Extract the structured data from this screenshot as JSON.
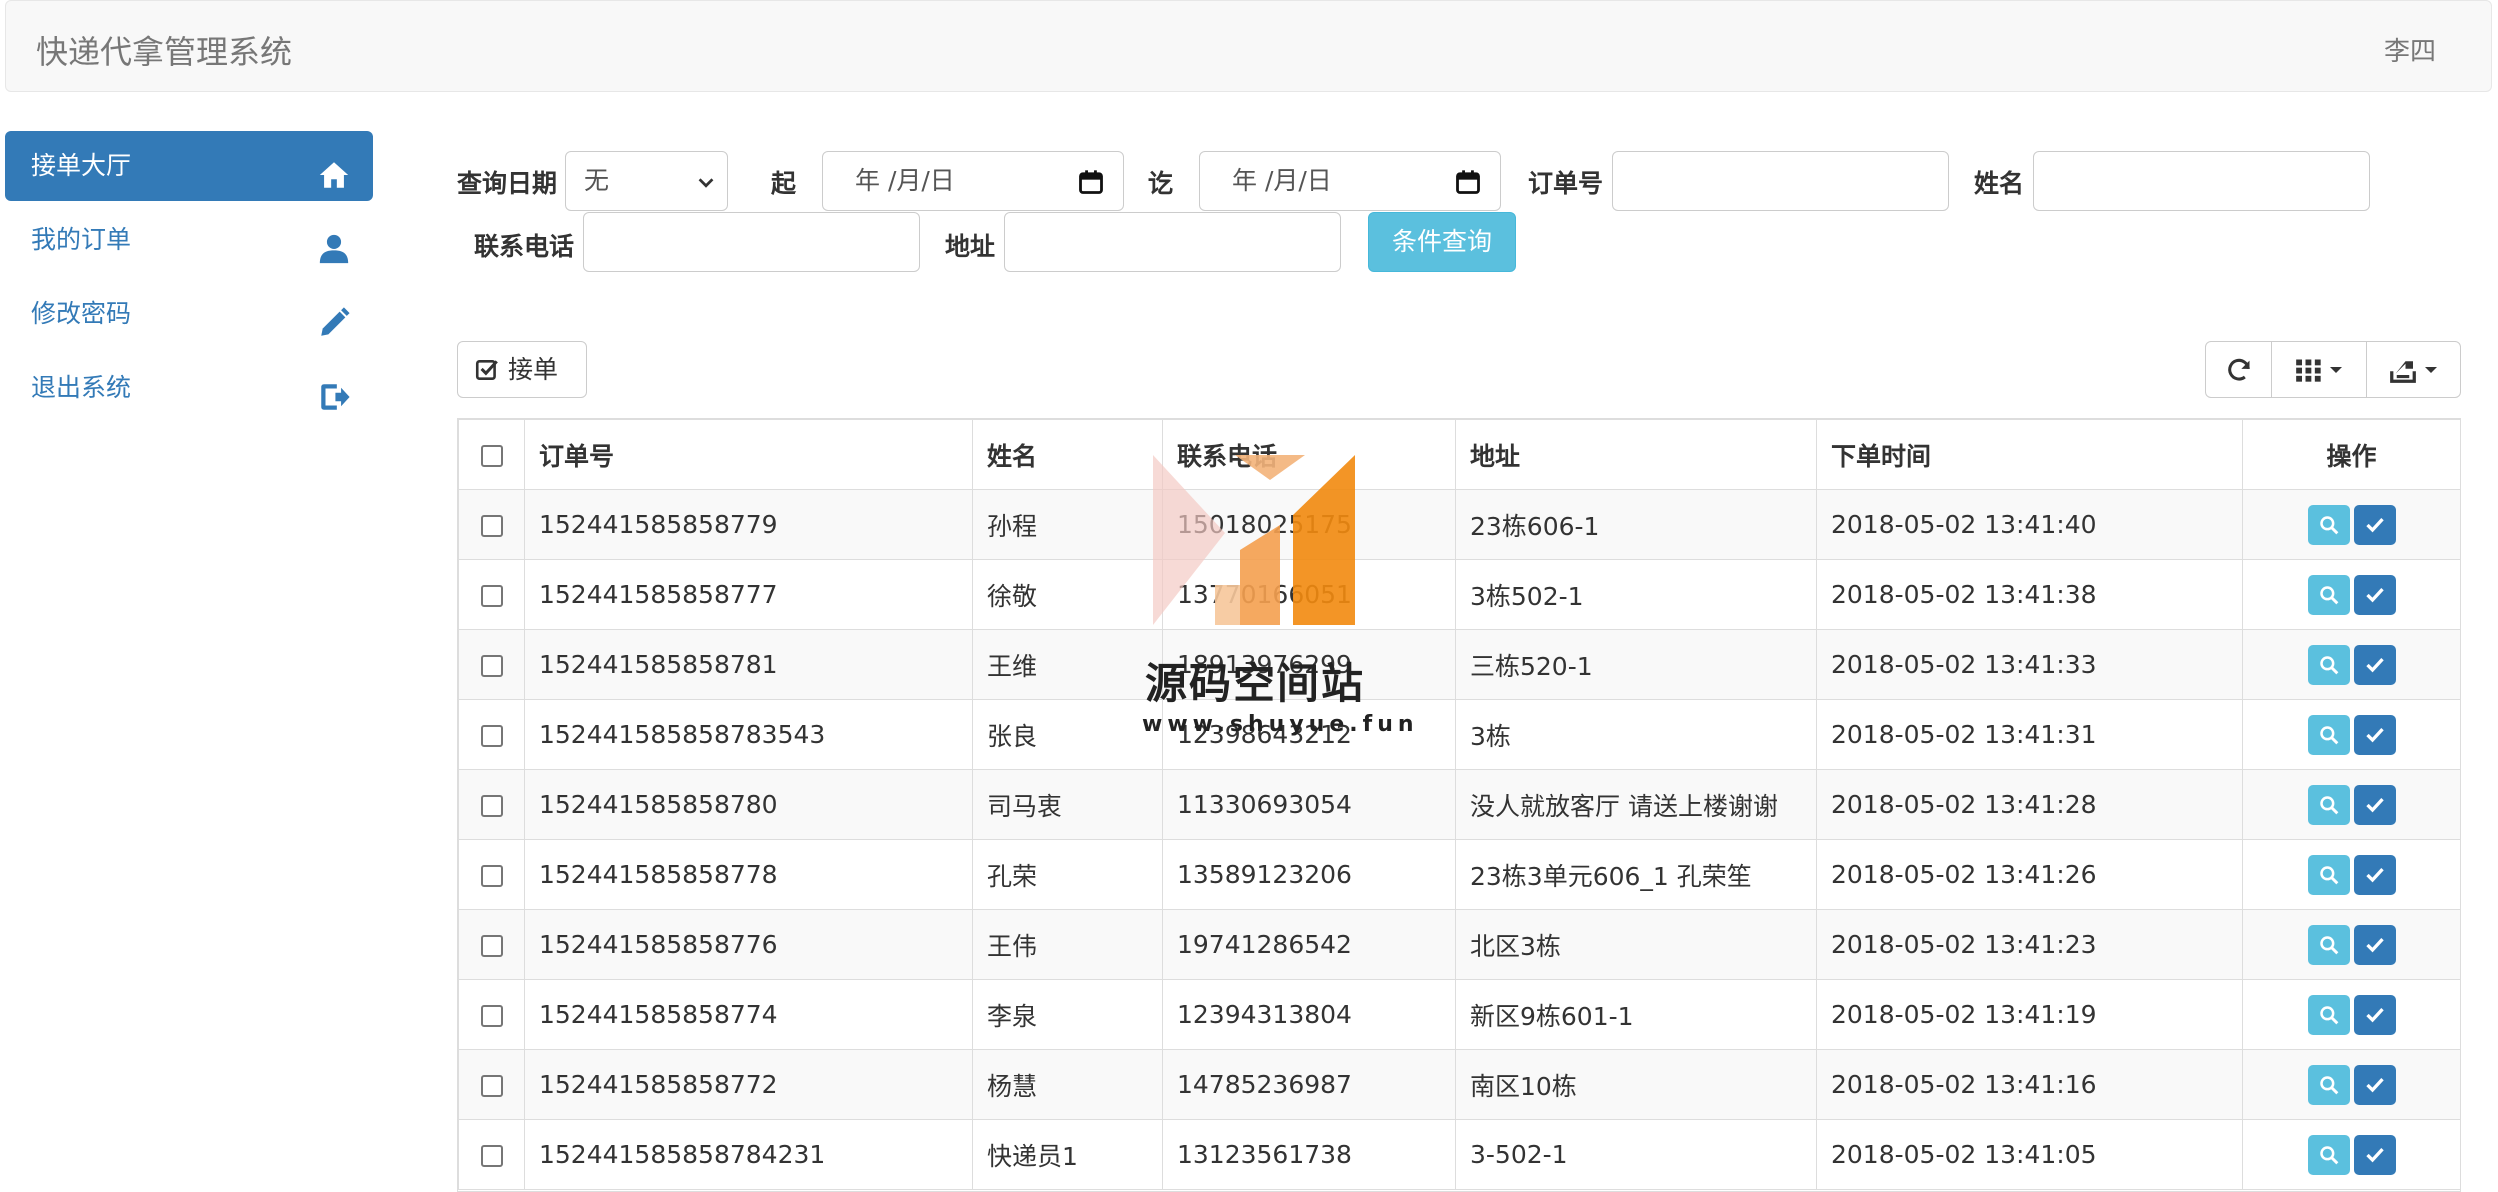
{
  "app": {
    "title": "快递代拿管理系统",
    "user": "李四"
  },
  "sidebar": {
    "items": [
      {
        "label": "接单大厅",
        "icon": "home-icon",
        "active": true
      },
      {
        "label": "我的订单",
        "icon": "user-icon"
      },
      {
        "label": "修改密码",
        "icon": "pencil-icon"
      },
      {
        "label": "退出系统",
        "icon": "logout-icon"
      }
    ]
  },
  "search": {
    "date_label": "查询日期",
    "date_select_value": "无",
    "from_label": "起",
    "from_placeholder": "年 /月/日",
    "to_label": "讫",
    "to_placeholder": "年 /月/日",
    "order_label": "订单号",
    "name_label": "姓名",
    "phone_label": "联系电话",
    "address_label": "地址",
    "button": "条件查询"
  },
  "toolbar": {
    "accept_label": "接单"
  },
  "table": {
    "headers": [
      "订单号",
      "姓名",
      "联系电话",
      "地址",
      "下单时间",
      "操作"
    ],
    "rows": [
      [
        "152441585858779",
        "孙程",
        "15018025175",
        "23栋606-1",
        "2018-05-02 13:41:40"
      ],
      [
        "152441585858777",
        "徐敬",
        "13770166051",
        "3栋502-1",
        "2018-05-02 13:41:38"
      ],
      [
        "152441585858781",
        "王维",
        "18913976299",
        "三栋520-1",
        "2018-05-02 13:41:33"
      ],
      [
        "152441585858783543",
        "张良",
        "12398643212",
        "3栋",
        "2018-05-02 13:41:31"
      ],
      [
        "152441585858780",
        "司马衷",
        "11330693054",
        "没人就放客厅 请送上楼谢谢",
        "2018-05-02 13:41:28"
      ],
      [
        "152441585858778",
        "孔荣",
        "13589123206",
        "23栋3单元606_1 孔荣笙",
        "2018-05-02 13:41:26"
      ],
      [
        "152441585858776",
        "王伟",
        "19741286542",
        "北区3栋",
        "2018-05-02 13:41:23"
      ],
      [
        "152441585858774",
        "李泉",
        "12394313804",
        "新区9栋601-1",
        "2018-05-02 13:41:19"
      ],
      [
        "152441585858772",
        "杨慧",
        "14785236987",
        "南区10栋",
        "2018-05-02 13:41:16"
      ],
      [
        "152441585858784231",
        "快递员1",
        "13123561738",
        "3-502-1",
        "2018-05-02 13:41:05"
      ]
    ]
  },
  "watermark": {
    "title": "源码空间站",
    "url": "www.shuyue.fun"
  },
  "colors": {
    "primary": "#337ab7",
    "info": "#5bc0de",
    "navbar_bg": "#f8f8f8"
  }
}
